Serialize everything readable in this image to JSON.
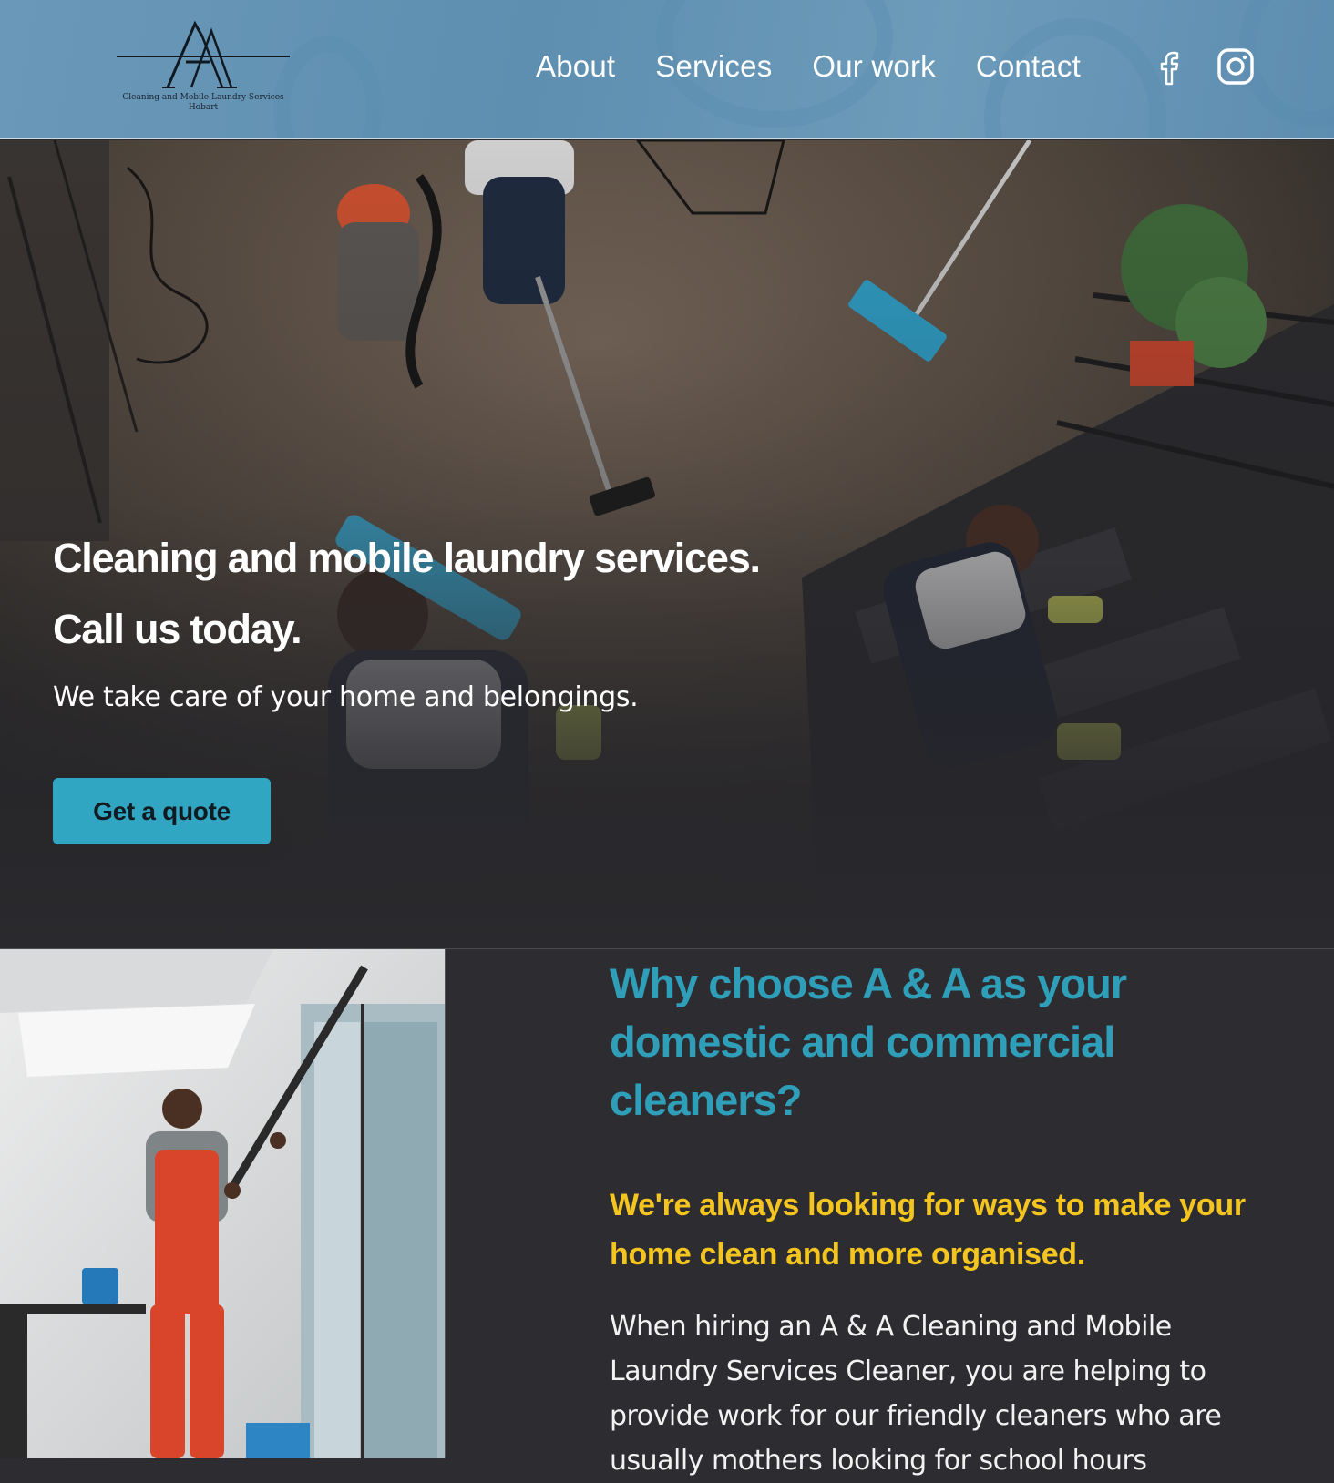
{
  "brand": {
    "logo_letters": "AA",
    "logo_caption_line1": "Cleaning and Mobile Laundry Services",
    "logo_caption_line2": "Hobart"
  },
  "nav": {
    "items": [
      {
        "label": "About"
      },
      {
        "label": "Services"
      },
      {
        "label": "Our work"
      },
      {
        "label": "Contact"
      }
    ],
    "social": [
      {
        "icon": "facebook-icon"
      },
      {
        "icon": "instagram-icon"
      }
    ]
  },
  "hero": {
    "title_line1": "Cleaning and mobile laundry services.",
    "title_line2": "Call us today.",
    "subtitle": "We take care of your home and belongings.",
    "cta_label": "Get a quote"
  },
  "why": {
    "heading": "Why choose A & A as your domestic and commercial cleaners?",
    "tagline": "We're always looking for ways to make your home clean and more organised.",
    "body": "When hiring an A & A Cleaning and Mobile Laundry Services Cleaner, you are helping to provide work for our friendly cleaners who are usually mothers looking for school hours"
  },
  "colors": {
    "header_bg": "#6a98b8",
    "accent_teal": "#31a6c2",
    "heading_teal": "#2f9fb9",
    "tagline_yellow": "#f4c51f",
    "page_bg": "#2d2d31"
  }
}
